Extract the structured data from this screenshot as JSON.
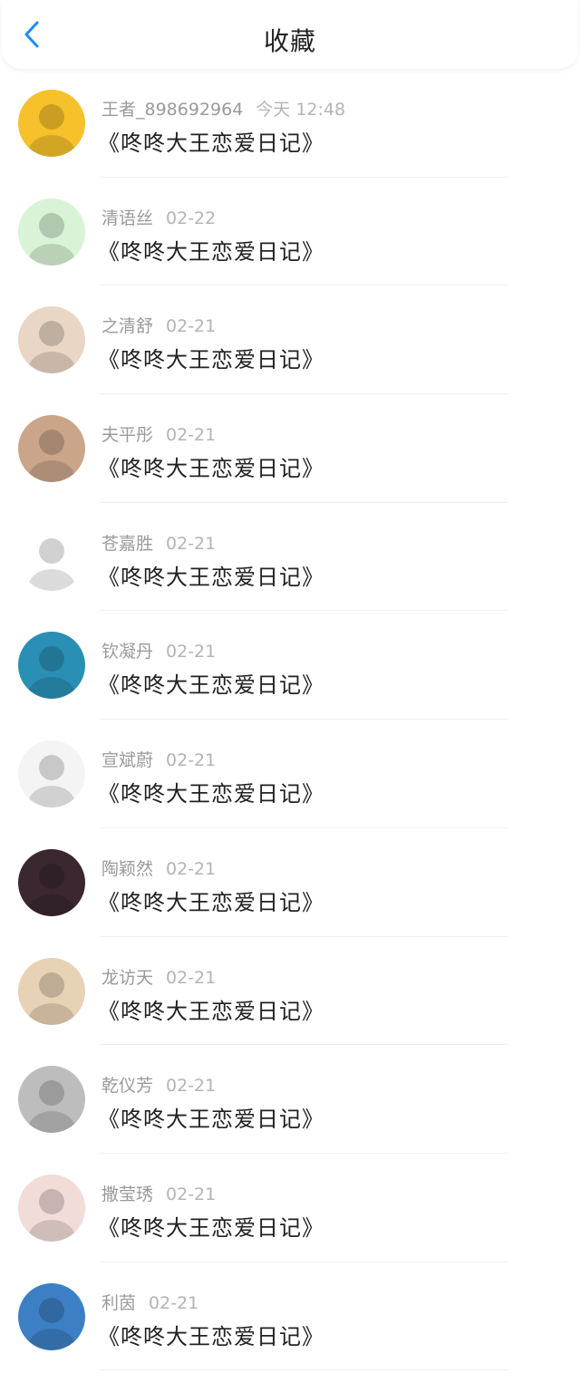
{
  "header": {
    "title": "收藏",
    "back_icon": "chevron-left-icon",
    "accent": "#1a8cff"
  },
  "items": [
    {
      "name": "王者_898692964",
      "time": "今天 12:48",
      "title": "《咚咚大王恋爱日记》",
      "avatar_color": "#f6c12a"
    },
    {
      "name": "清语丝",
      "time": "02-22",
      "title": "《咚咚大王恋爱日记》",
      "avatar_color": "#d9f3d6"
    },
    {
      "name": "之清舒",
      "time": "02-21",
      "title": "《咚咚大王恋爱日记》",
      "avatar_color": "#e9d6c4"
    },
    {
      "name": "夫平彤",
      "time": "02-21",
      "title": "《咚咚大王恋爱日记》",
      "avatar_color": "#caa58a"
    },
    {
      "name": "苍嘉胜",
      "time": "02-21",
      "title": "《咚咚大王恋爱日记》",
      "avatar_color": "#ffffff"
    },
    {
      "name": "钦凝丹",
      "time": "02-21",
      "title": "《咚咚大王恋爱日记》",
      "avatar_color": "#2a8fb5"
    },
    {
      "name": "宣斌蔚",
      "time": "02-21",
      "title": "《咚咚大王恋爱日记》",
      "avatar_color": "#f4f4f4"
    },
    {
      "name": "陶颖然",
      "time": "02-21",
      "title": "《咚咚大王恋爱日记》",
      "avatar_color": "#3a2730"
    },
    {
      "name": "龙访天",
      "time": "02-21",
      "title": "《咚咚大王恋爱日记》",
      "avatar_color": "#e8d2b5"
    },
    {
      "name": "乾仪芳",
      "time": "02-21",
      "title": "《咚咚大王恋爱日记》",
      "avatar_color": "#bdbdbd"
    },
    {
      "name": "撒莹琇",
      "time": "02-21",
      "title": "《咚咚大王恋爱日记》",
      "avatar_color": "#f1dcd8"
    },
    {
      "name": "利茵",
      "time": "02-21",
      "title": "《咚咚大王恋爱日记》",
      "avatar_color": "#3c7fc4"
    }
  ]
}
